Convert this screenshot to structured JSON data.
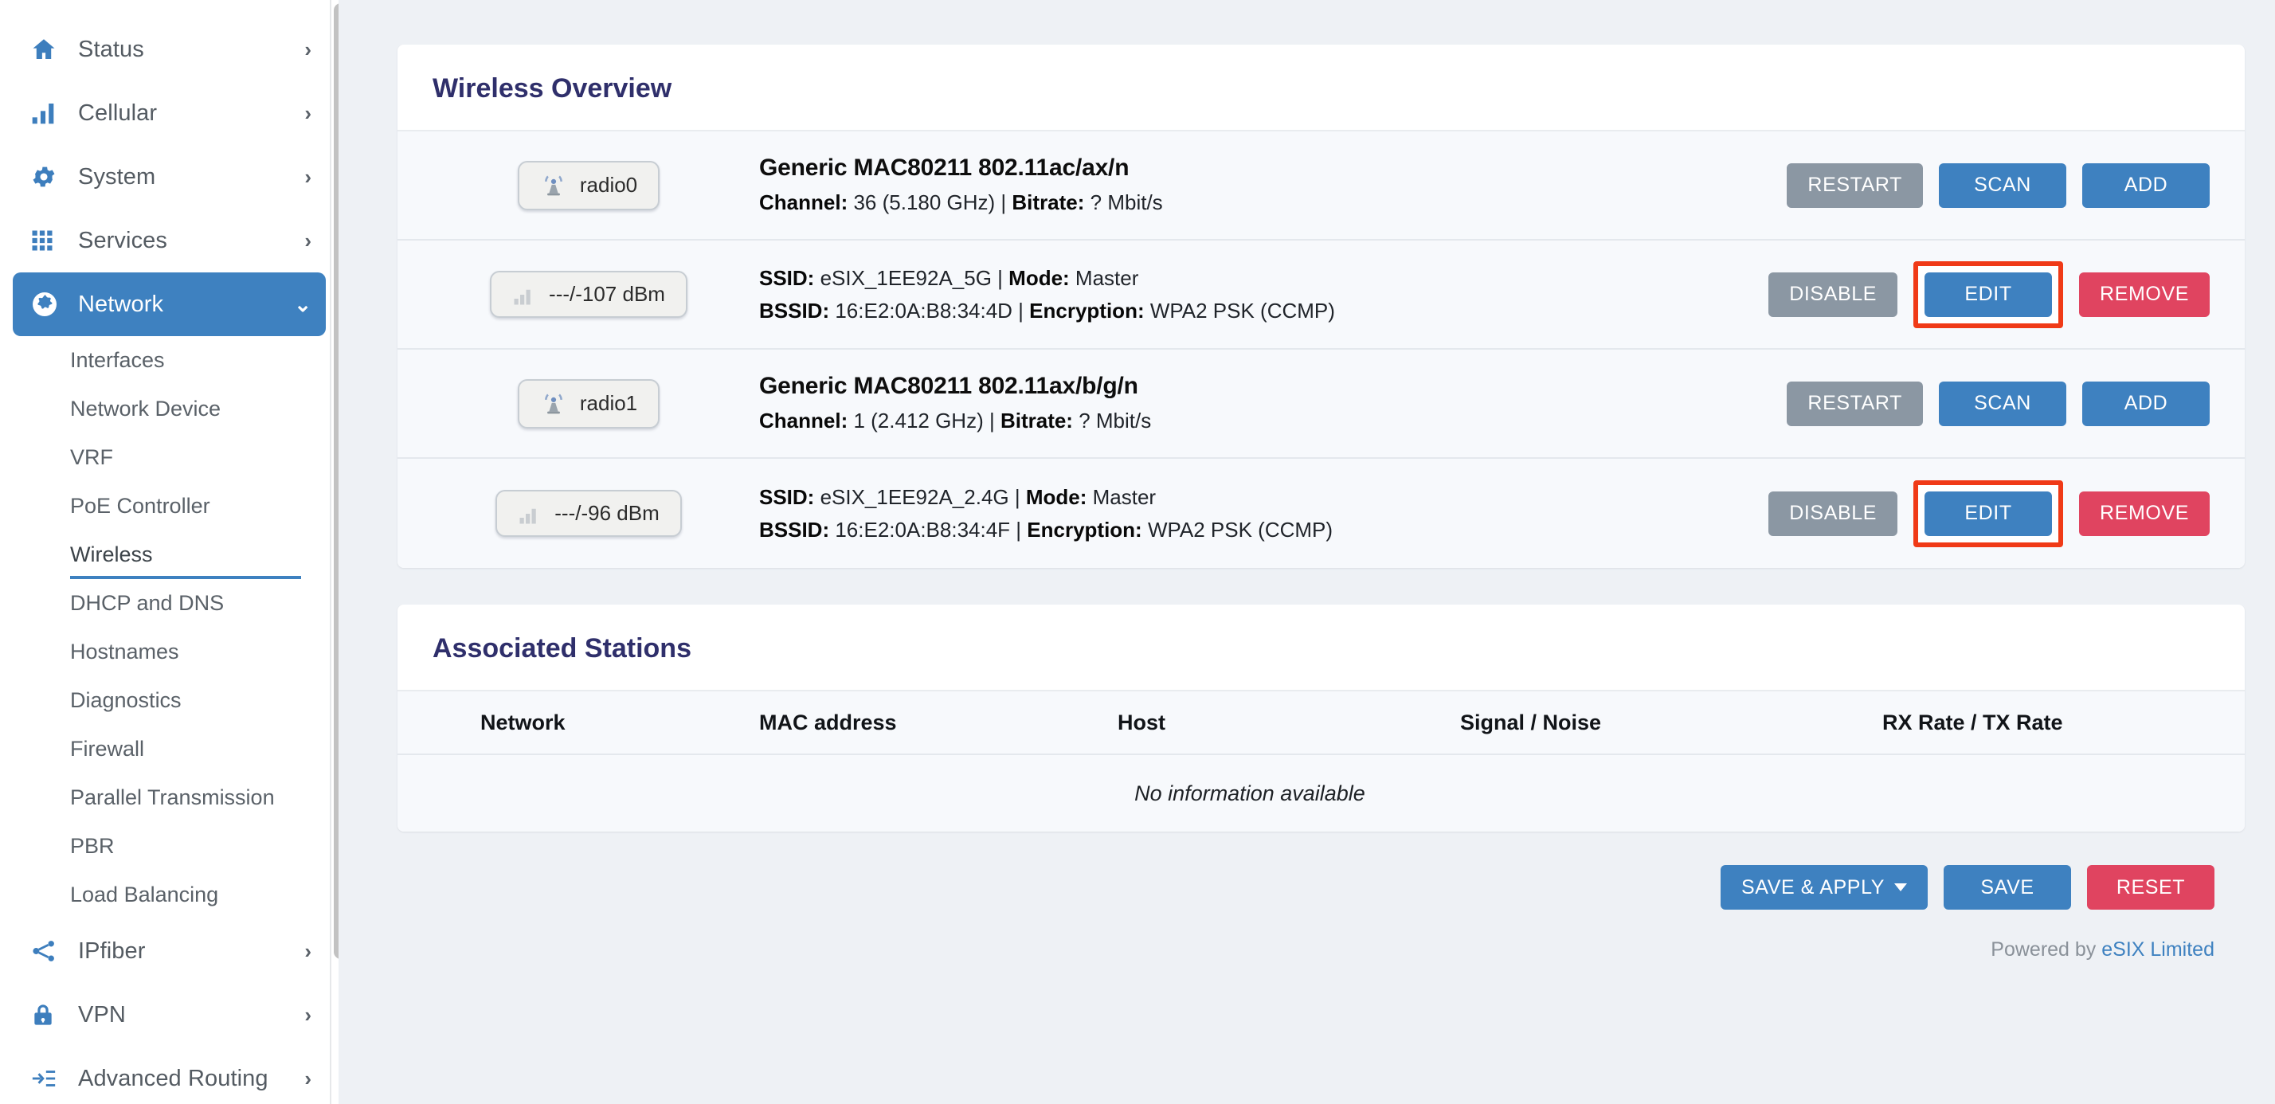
{
  "sidebar": {
    "top_items": [
      {
        "label": "Status",
        "icon": "home-icon",
        "chevron": "›",
        "active": false
      },
      {
        "label": "Cellular",
        "icon": "bar-chart-icon",
        "chevron": "›",
        "active": false
      },
      {
        "label": "System",
        "icon": "gear-icon",
        "chevron": "›",
        "active": false
      },
      {
        "label": "Services",
        "icon": "grid-icon",
        "chevron": "›",
        "active": false
      },
      {
        "label": "Network",
        "icon": "globe-icon",
        "chevron": "⌄",
        "active": true
      }
    ],
    "network_sub_items": [
      {
        "label": "Interfaces",
        "current": false
      },
      {
        "label": "Network Device",
        "current": false
      },
      {
        "label": "VRF",
        "current": false
      },
      {
        "label": "PoE Controller",
        "current": false
      },
      {
        "label": "Wireless",
        "current": true
      },
      {
        "label": "DHCP and DNS",
        "current": false
      },
      {
        "label": "Hostnames",
        "current": false
      },
      {
        "label": "Diagnostics",
        "current": false
      },
      {
        "label": "Firewall",
        "current": false
      },
      {
        "label": "Parallel Transmission",
        "current": false
      },
      {
        "label": "PBR",
        "current": false
      },
      {
        "label": "Load Balancing",
        "current": false
      }
    ],
    "bottom_items": [
      {
        "label": "IPfiber",
        "icon": "share-icon",
        "chevron": "›"
      },
      {
        "label": "VPN",
        "icon": "lock-icon",
        "chevron": "›"
      },
      {
        "label": "Advanced Routing",
        "icon": "route-in-icon",
        "chevron": "›"
      }
    ]
  },
  "wireless_overview": {
    "title": "Wireless Overview",
    "rows": [
      {
        "kind": "radio",
        "badge_icon": "wifi-tower-icon",
        "badge_label": "radio0",
        "title": "Generic MAC80211 802.11ac/ax/n",
        "line_label_1": "Channel:",
        "line_value_1": " 36 (5.180 GHz) | ",
        "line_label_2": "Bitrate:",
        "line_value_2": " ? Mbit/s",
        "buttons": [
          {
            "label": "RESTART",
            "style": "grey",
            "highlighted": false
          },
          {
            "label": "SCAN",
            "style": "blue",
            "highlighted": false
          },
          {
            "label": "ADD",
            "style": "blue",
            "highlighted": false
          }
        ]
      },
      {
        "kind": "iface",
        "badge_icon": "signal-bars-icon",
        "badge_label": "---/-107 dBm",
        "l1_label_1": "SSID:",
        "l1_value_1": " eSIX_1EE92A_5G | ",
        "l1_label_2": "Mode:",
        "l1_value_2": " Master",
        "l2_label_1": "BSSID:",
        "l2_value_1": " 16:E2:0A:B8:34:4D | ",
        "l2_label_2": "Encryption:",
        "l2_value_2": " WPA2 PSK (CCMP)",
        "buttons": [
          {
            "label": "DISABLE",
            "style": "grey",
            "highlighted": false
          },
          {
            "label": "EDIT",
            "style": "blue",
            "highlighted": true
          },
          {
            "label": "REMOVE",
            "style": "red",
            "highlighted": false
          }
        ]
      },
      {
        "kind": "radio",
        "badge_icon": "wifi-tower-icon",
        "badge_label": "radio1",
        "title": "Generic MAC80211 802.11ax/b/g/n",
        "line_label_1": "Channel:",
        "line_value_1": " 1 (2.412 GHz) | ",
        "line_label_2": "Bitrate:",
        "line_value_2": " ? Mbit/s",
        "buttons": [
          {
            "label": "RESTART",
            "style": "grey",
            "highlighted": false
          },
          {
            "label": "SCAN",
            "style": "blue",
            "highlighted": false
          },
          {
            "label": "ADD",
            "style": "blue",
            "highlighted": false
          }
        ]
      },
      {
        "kind": "iface",
        "badge_icon": "signal-bars-icon",
        "badge_label": "---/-96 dBm",
        "l1_label_1": "SSID:",
        "l1_value_1": " eSIX_1EE92A_2.4G | ",
        "l1_label_2": "Mode:",
        "l1_value_2": " Master",
        "l2_label_1": "BSSID:",
        "l2_value_1": " 16:E2:0A:B8:34:4F | ",
        "l2_label_2": "Encryption:",
        "l2_value_2": " WPA2 PSK (CCMP)",
        "buttons": [
          {
            "label": "DISABLE",
            "style": "grey",
            "highlighted": false
          },
          {
            "label": "EDIT",
            "style": "blue",
            "highlighted": true
          },
          {
            "label": "REMOVE",
            "style": "red",
            "highlighted": false
          }
        ]
      }
    ]
  },
  "associated_stations": {
    "title": "Associated Stations",
    "columns": [
      "Network",
      "MAC address",
      "Host",
      "Signal / Noise",
      "RX Rate / TX Rate"
    ],
    "empty_message": "No information available"
  },
  "footer": {
    "save_apply_label": "SAVE & APPLY",
    "save_label": "SAVE",
    "reset_label": "RESET",
    "powered_prefix": "Powered by ",
    "powered_link": "eSIX Limited"
  },
  "colors": {
    "accent_blue": "#3e81c0",
    "grey_button": "#8b97a3",
    "danger_red": "#e04460",
    "highlight_outline": "#f03a17",
    "title_navy": "#2f2f6b",
    "page_bg": "#eef1f5",
    "row_bg": "#f7f9fc"
  }
}
